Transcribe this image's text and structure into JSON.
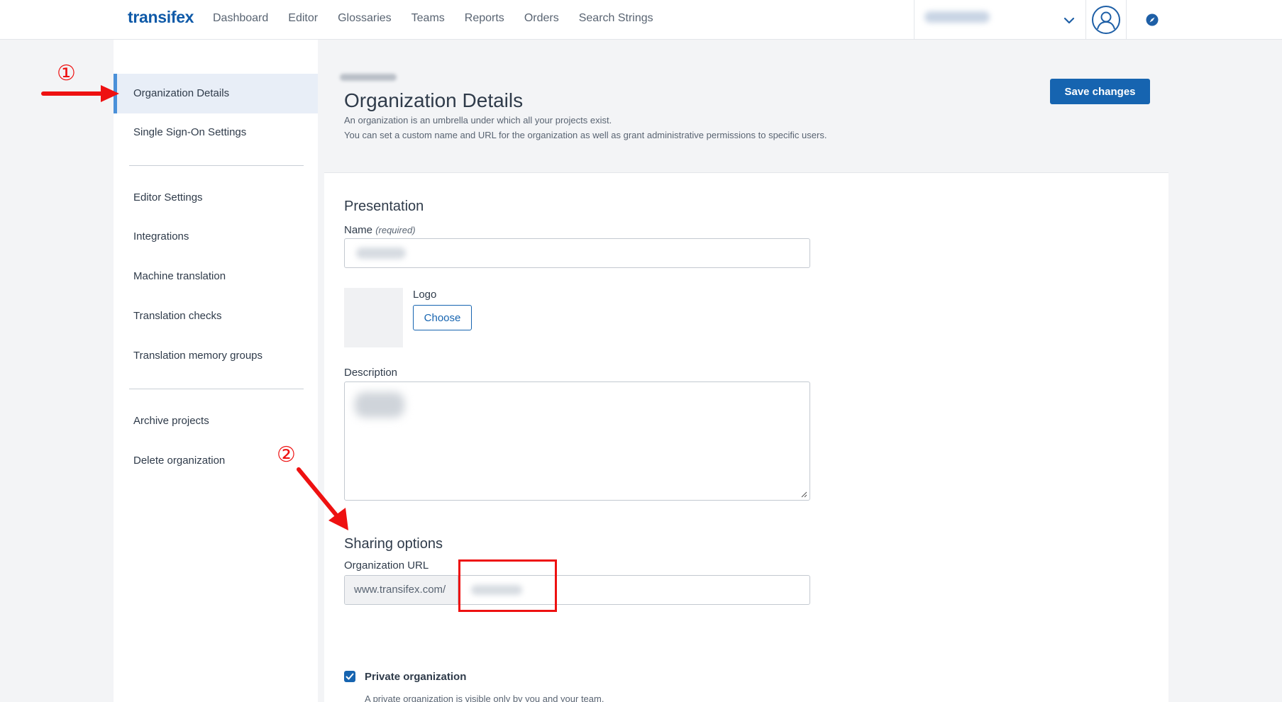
{
  "app": {
    "logo_text": "transifex",
    "nav": [
      "Dashboard",
      "Editor",
      "Glossaries",
      "Teams",
      "Reports",
      "Orders",
      "Search Strings"
    ]
  },
  "icons": {
    "org_switch": "chevron-down-icon",
    "profile": "user-avatar-icon",
    "help": "compass-icon"
  },
  "colors": {
    "brand": "#0f5aa8",
    "primary_button": "#1664b0",
    "active_indicator": "#4a90d9",
    "annotation": "#ee1111"
  },
  "sidebar": {
    "group1": [
      "Organization Details",
      "Single Sign-On Settings"
    ],
    "group2": [
      "Editor Settings",
      "Integrations",
      "Machine translation",
      "Translation checks",
      "Translation memory groups"
    ],
    "group3": [
      "Archive projects",
      "Delete organization"
    ],
    "active": "Organization Details"
  },
  "header": {
    "title": "Organization Details",
    "desc_line1": "An organization is an umbrella under which all your projects exist.",
    "desc_line2": "You can set a custom name and URL for the organization as well as grant administrative permissions to specific users.",
    "save_label": "Save changes"
  },
  "presentation": {
    "section_title": "Presentation",
    "name_label": "Name",
    "name_required": "(required)",
    "logo_label": "Logo",
    "choose_label": "Choose",
    "description_label": "Description"
  },
  "sharing": {
    "section_title": "Sharing options",
    "url_label": "Organization URL",
    "url_prefix": "www.transifex.com/",
    "private_label": "Private organization",
    "private_checked": true,
    "private_help": "A private organization is visible only by you and your team."
  },
  "annotations": {
    "marker1": "①",
    "marker2": "②"
  }
}
